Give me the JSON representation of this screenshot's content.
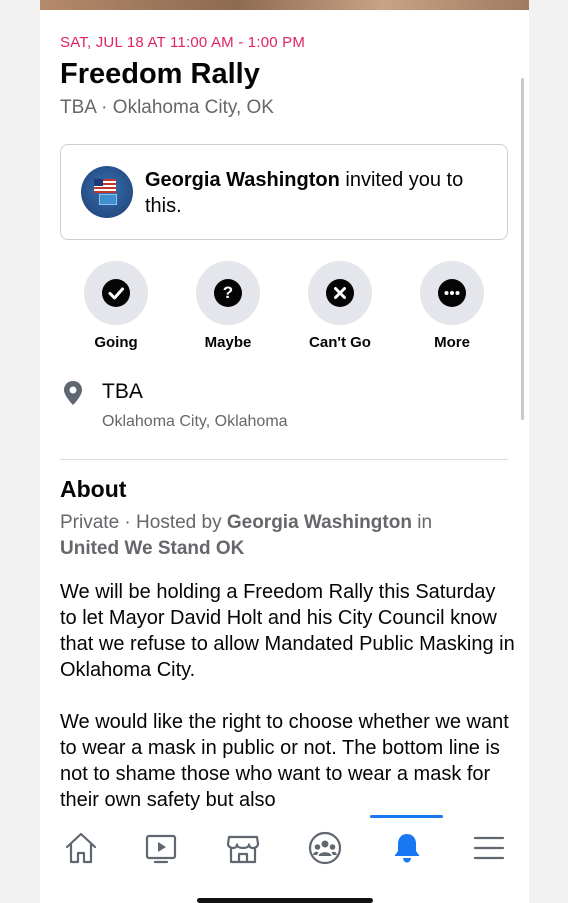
{
  "event": {
    "date_time": "SAT, JUL 18 AT 11:00 AM - 1:00 PM",
    "title": "Freedom Rally",
    "location_summary": "TBA · Oklahoma City, OK"
  },
  "invite": {
    "inviter": "Georgia Washington",
    "message_rest": " invited you to this."
  },
  "rsvp": [
    {
      "label": "Going",
      "icon": "check-icon"
    },
    {
      "label": "Maybe",
      "icon": "question-icon"
    },
    {
      "label": "Can't Go",
      "icon": "x-icon"
    },
    {
      "label": "More",
      "icon": "more-icon"
    }
  ],
  "location": {
    "name": "TBA",
    "city": "Oklahoma City, Oklahoma"
  },
  "about": {
    "heading": "About",
    "privacy": "Private",
    "hosted_by_prefix": " · Hosted by ",
    "host": "Georgia Washington",
    "in_word": " in",
    "group": "United We Stand OK",
    "paragraph1": "We will be holding a Freedom Rally this Saturday to let Mayor David Holt and his City Council know that we refuse to allow Mandated Public Masking in Oklahoma City.",
    "paragraph2": "We would like the right to choose whether we want to wear a mask in public or not. The bottom line is not to shame those who want to wear a mask for their own safety but also"
  },
  "bottom_nav": [
    {
      "name": "home-icon",
      "active": false
    },
    {
      "name": "watch-icon",
      "active": false
    },
    {
      "name": "marketplace-icon",
      "active": false
    },
    {
      "name": "groups-icon",
      "active": false
    },
    {
      "name": "notifications-bell-icon",
      "active": true
    },
    {
      "name": "menu-icon",
      "active": false
    }
  ],
  "colors": {
    "accent": "#1877f2",
    "date": "#e0245e",
    "secondary_text": "#65676b"
  }
}
